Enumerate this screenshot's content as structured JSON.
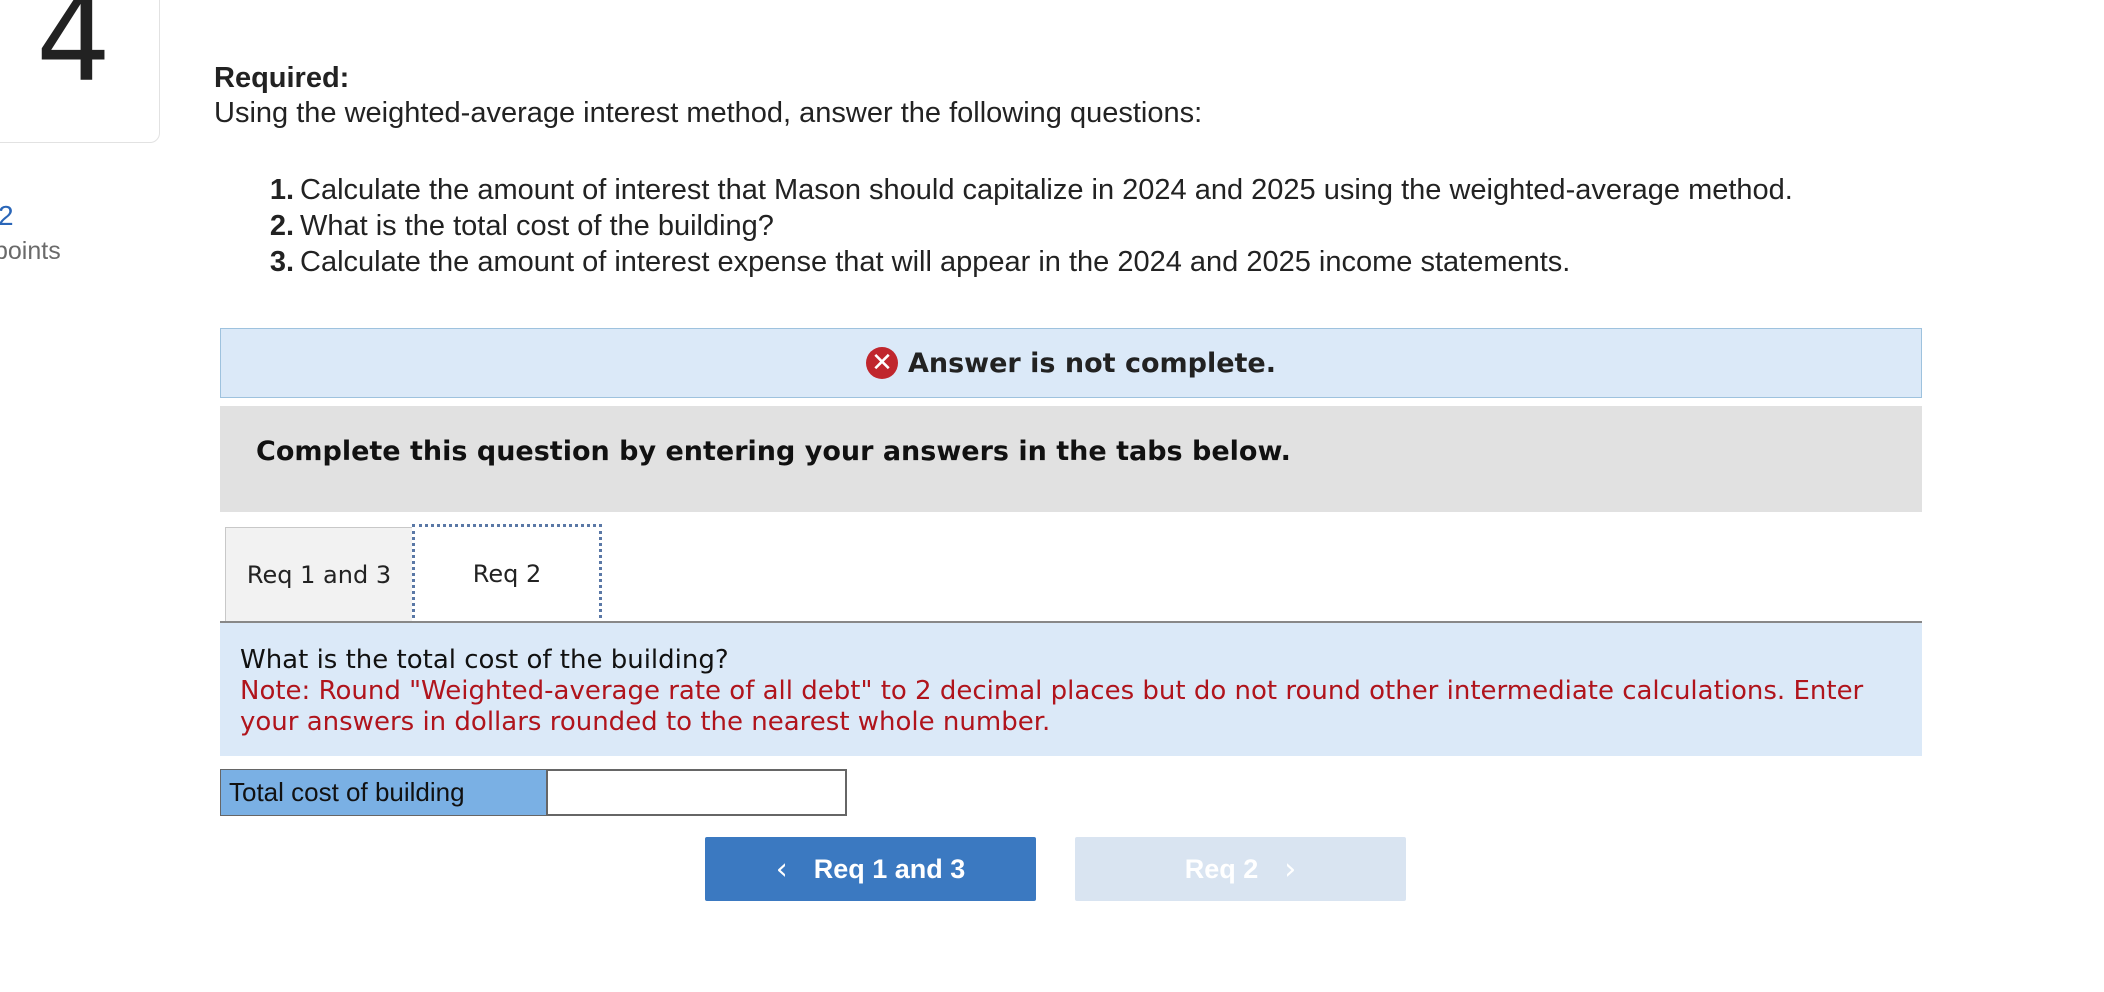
{
  "question": {
    "number": "4",
    "points_value": "2",
    "points_label": "points"
  },
  "required_label": "Required:",
  "instructions": "Using the weighted-average interest method, answer the following questions:",
  "requirements": [
    {
      "num": "1.",
      "text": "Calculate the amount of interest that Mason should capitalize in 2024 and 2025 using the weighted-average method."
    },
    {
      "num": "2.",
      "text": "What is the total cost of the building?"
    },
    {
      "num": "3.",
      "text": "Calculate the amount of interest expense that will appear in the 2024 and 2025 income statements."
    }
  ],
  "banner": {
    "icon": "x-circle-icon",
    "text": "Answer is not complete."
  },
  "instruction_box": "Complete this question by entering your answers in the tabs below.",
  "tabs": [
    {
      "label": "Req 1 and 3",
      "active": false
    },
    {
      "label": "Req 2",
      "active": true
    }
  ],
  "question_panel": {
    "question": "What is the total cost of the building?",
    "note": "Note: Round \"Weighted-average rate of all debt\" to 2 decimal places but do not round other intermediate calculations. Enter your answers in dollars rounded to the nearest whole number."
  },
  "answer_row": {
    "label": "Total cost of building",
    "value": ""
  },
  "nav": {
    "prev_label": "Req 1 and 3",
    "next_label": "Req 2"
  },
  "colors": {
    "accent": "#3b79c1",
    "error": "#c0262d",
    "note": "#b0141c",
    "panel": "#dbe9f8",
    "label_cell": "#7ab0e4"
  }
}
